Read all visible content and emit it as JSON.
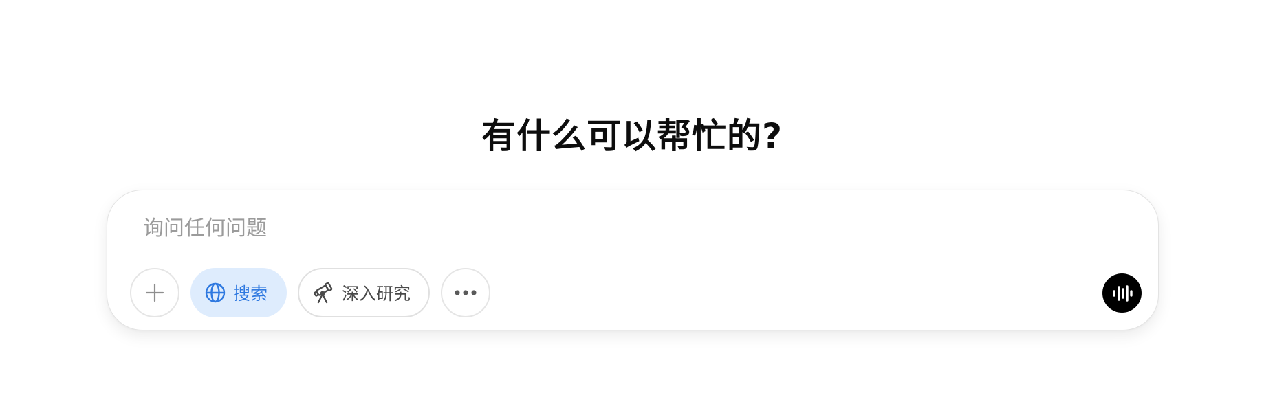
{
  "headline": "有什么可以帮忙的?",
  "composer": {
    "placeholder": "询问任何问题",
    "value": ""
  },
  "toolbar": {
    "add_icon": "plus-icon",
    "search_label": "搜索",
    "search_icon": "globe-icon",
    "search_active": true,
    "research_label": "深入研究",
    "research_icon": "telescope-icon",
    "more_icon": "ellipsis-icon",
    "voice_icon": "voice-waveform-icon"
  },
  "colors": {
    "search_active_bg": "#deecfd",
    "search_active_fg": "#2f79e0",
    "voice_button_bg": "#000000"
  }
}
